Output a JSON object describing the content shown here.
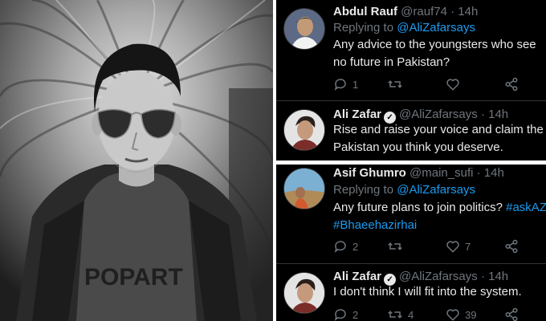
{
  "tweets": [
    {
      "name": "Abdul Rauf",
      "handle": "@rauf74",
      "time": "· 14h",
      "replying_label": "Replying to",
      "replying_to": "@AliZafarsays",
      "text": "Any advice to the youngsters who see no future in Pakistan?",
      "replies": "1",
      "retweets": "",
      "likes": ""
    },
    {
      "name": "Ali Zafar",
      "verified": "✓",
      "handle": "@AliZafarsays",
      "time": "· 14h",
      "text": "Rise and raise your voice and claim the Pakistan you think you deserve."
    },
    {
      "name": "Asif Ghumro",
      "handle": "@main_sufi",
      "time": "· 14h",
      "replying_label": "Replying to",
      "replying_to": "@AliZafarsays",
      "text": "Any future plans to join politics?",
      "hashtag1": "#askAZ",
      "hashtag2": "#Bhaeehazirhai",
      "replies": "2",
      "retweets": "",
      "likes": "7"
    },
    {
      "name": "Ali Zafar",
      "verified": "✓",
      "handle": "@AliZafarsays",
      "time": "· 14h",
      "text": "I don't think I will fit into the system.",
      "replies": "2",
      "retweets": "4",
      "likes": "39"
    }
  ],
  "colors": {
    "background": "#000000",
    "text": "#e9e9ea",
    "muted": "#6e767d",
    "accent": "#1d9bf0"
  },
  "icons": [
    "reply-icon",
    "retweet-icon",
    "like-icon",
    "share-icon",
    "verified-badge-icon"
  ]
}
